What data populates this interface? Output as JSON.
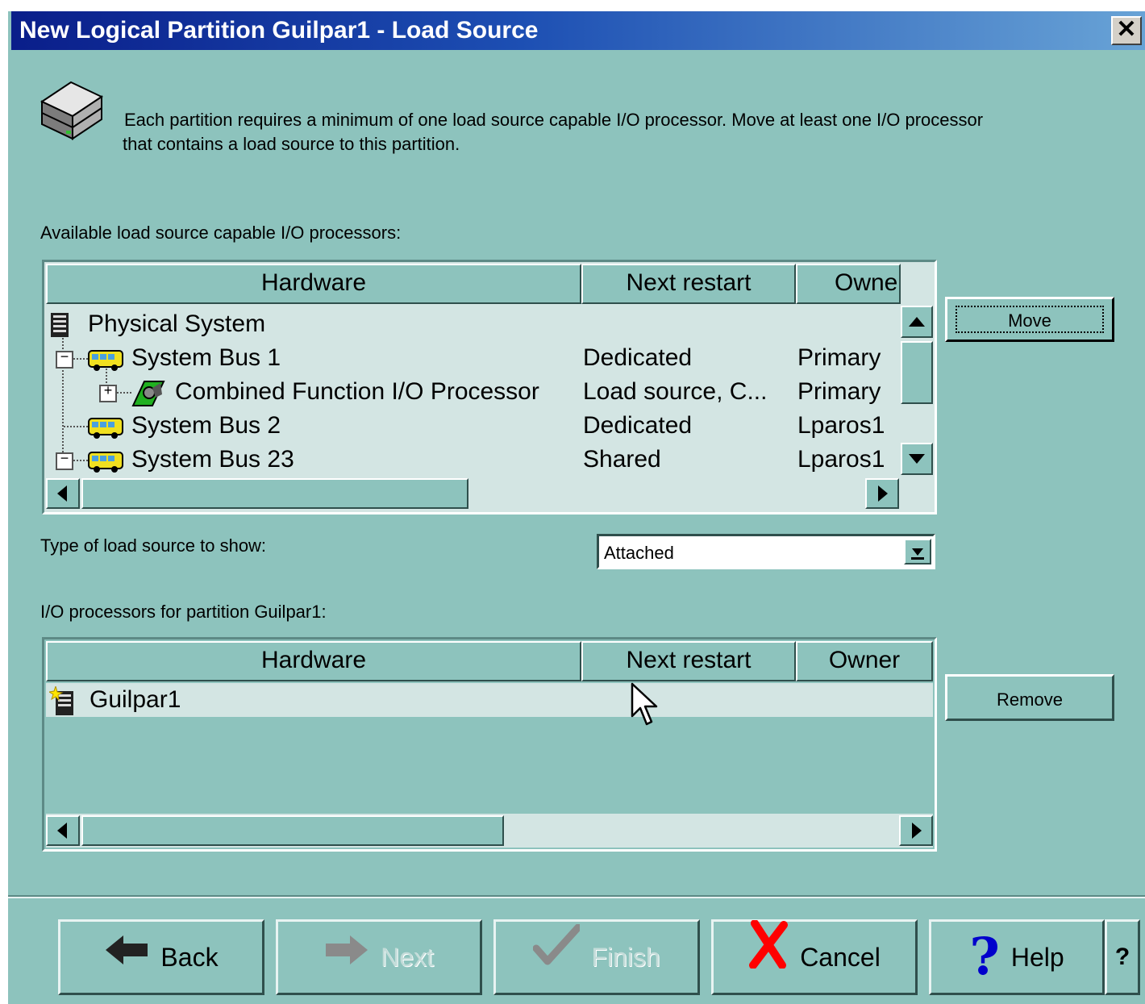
{
  "window": {
    "title": "New Logical Partition Guilpar1 - Load Source",
    "close_label": "✕"
  },
  "intro": {
    "text_line1": "Each partition requires a minimum of one load source capable I/O processor. Move at least one I/O processor",
    "text_line2": "that contains a load source to this partition."
  },
  "available": {
    "label": "Available load source capable I/O processors:",
    "columns": [
      "Hardware",
      "Next restart",
      "Owne"
    ],
    "rows": [
      {
        "hardware": "Physical System",
        "next_restart": "",
        "owner": ""
      },
      {
        "hardware": "System Bus 1",
        "next_restart": "Dedicated",
        "owner": "Primary"
      },
      {
        "hardware": "Combined Function I/O Processor",
        "next_restart": "Load source, C...",
        "owner": "Primary"
      },
      {
        "hardware": "System Bus 2",
        "next_restart": "Dedicated",
        "owner": "Lparos1"
      },
      {
        "hardware": "System Bus 23",
        "next_restart": "Shared",
        "owner": "Lparos1"
      }
    ],
    "move_label": "Move"
  },
  "type_filter": {
    "label": "Type of load source to show:",
    "value": "Attached"
  },
  "partition": {
    "label": "I/O processors for partition Guilpar1:",
    "columns": [
      "Hardware",
      "Next restart",
      "Owner"
    ],
    "rows": [
      {
        "hardware": "Guilpar1",
        "next_restart": "",
        "owner": ""
      }
    ],
    "remove_label": "Remove"
  },
  "nav": {
    "back": "Back",
    "next": "Next",
    "finish": "Finish",
    "cancel": "Cancel",
    "help": "Help",
    "whats_this": "?"
  },
  "colors": {
    "dialog_bg": "#8dc3bd",
    "title_start": "#0a1e8a",
    "title_end": "#68a3d6",
    "cancel_x": "#ff0000",
    "help_q": "#0000cc"
  }
}
